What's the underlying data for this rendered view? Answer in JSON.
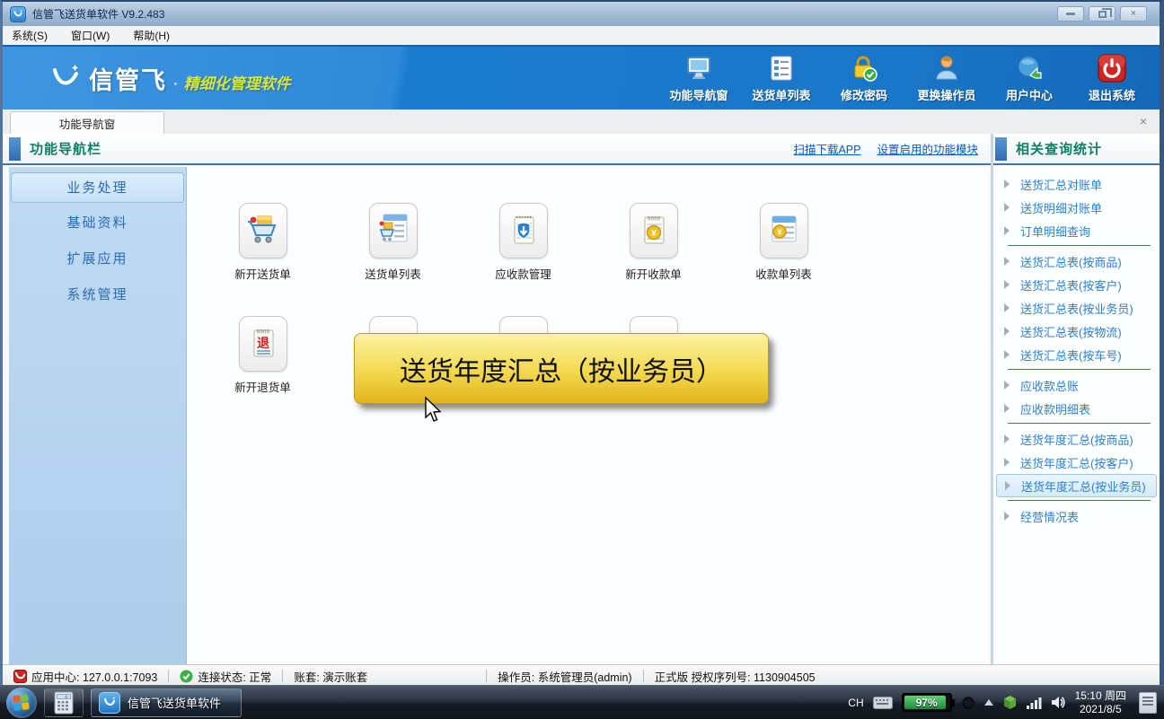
{
  "window": {
    "title": "信管飞送货单软件 V9.2.483",
    "close_glyph": "×"
  },
  "menu": {
    "items": [
      {
        "label": "系统(S)"
      },
      {
        "label": "窗口(W)"
      },
      {
        "label": "帮助(H)"
      }
    ]
  },
  "brand": {
    "name": "信管飞",
    "separator": "·",
    "slogan": "精细化管理软件"
  },
  "toolbar": {
    "buttons": [
      {
        "label": "功能导航窗",
        "icon": "monitor-icon"
      },
      {
        "label": "送货单列表",
        "icon": "list-icon"
      },
      {
        "label": "修改密码",
        "icon": "lock-check-icon"
      },
      {
        "label": "更换操作员",
        "icon": "operator-person-icon"
      },
      {
        "label": "用户中心",
        "icon": "globe-arrow-icon"
      },
      {
        "label": "退出系统",
        "icon": "power-icon"
      }
    ]
  },
  "tab_strip": {
    "active_tab": "功能导航窗",
    "close_glyph": "×"
  },
  "nav_header": {
    "title": "功能导航栏",
    "links": [
      {
        "label": "扫描下载APP"
      },
      {
        "label": "设置启用的功能模块"
      }
    ]
  },
  "sidebar": {
    "items": [
      {
        "label": "业务处理",
        "selected": true
      },
      {
        "label": "基础资料",
        "selected": false
      },
      {
        "label": "扩展应用",
        "selected": false
      },
      {
        "label": "系统管理",
        "selected": false
      }
    ]
  },
  "main": {
    "row1": [
      {
        "label": "新开送货单",
        "icon": "cart-new-icon"
      },
      {
        "label": "送货单列表",
        "icon": "cart-list-icon"
      },
      {
        "label": "应收款管理",
        "icon": "receivable-shield-icon"
      },
      {
        "label": "新开收款单",
        "icon": "receipt-coin-icon"
      },
      {
        "label": "收款单列表",
        "icon": "receipt-list-coin-icon"
      }
    ],
    "row2": [
      {
        "label": "新开退货单",
        "icon": "return-note-icon"
      }
    ]
  },
  "tooltip": {
    "text": "送货年度汇总（按业务员）"
  },
  "right_panel": {
    "title": "相关查询统计",
    "items": [
      {
        "label": "送货汇总对账单"
      },
      {
        "label": "送货明细对账单"
      },
      {
        "label": "订单明细查询",
        "divider_after": true
      },
      {
        "label": "送货汇总表(按商品)"
      },
      {
        "label": "送货汇总表(按客户)"
      },
      {
        "label": "送货汇总表(按业务员)"
      },
      {
        "label": "送货汇总表(按物流)"
      },
      {
        "label": "送货汇总表(按车号)",
        "divider_after": true
      },
      {
        "label": "应收款总账"
      },
      {
        "label": "应收款明细表",
        "divider_after": true
      },
      {
        "label": "送货年度汇总(按商品)"
      },
      {
        "label": "送货年度汇总(按客户)"
      },
      {
        "label": "送货年度汇总(按业务员)",
        "selected": true,
        "divider_after": true
      },
      {
        "label": "经营情况表"
      }
    ]
  },
  "status_bar": {
    "app_center": "应用中心: 127.0.0.1:7093",
    "connection": "连接状态: 正常",
    "account": "账套: 演示账套",
    "operator": "操作员: 系统管理员(admin)",
    "license": "正式版 授权序列号: 1130904505"
  },
  "taskbar": {
    "app_button": "信管飞送货单软件",
    "tray": {
      "ime": "CH",
      "battery": "97%",
      "time": "15:10 周四",
      "date": "2021/8/5"
    }
  },
  "colors": {
    "toolbar_blue": "#1b7ccf",
    "slogan_yellow": "#d8e53a",
    "header_teal": "#0e8068",
    "link_blue": "#0a58c4",
    "sidebar_text_blue": "#2b6cb5",
    "panel_item_blue": "#2a80d8",
    "tooltip_top": "#fbf3a2",
    "tooltip_bottom": "#e2b51c",
    "battery_green": "#1f8a3a",
    "selected_item_bg": "#d5eafa"
  }
}
